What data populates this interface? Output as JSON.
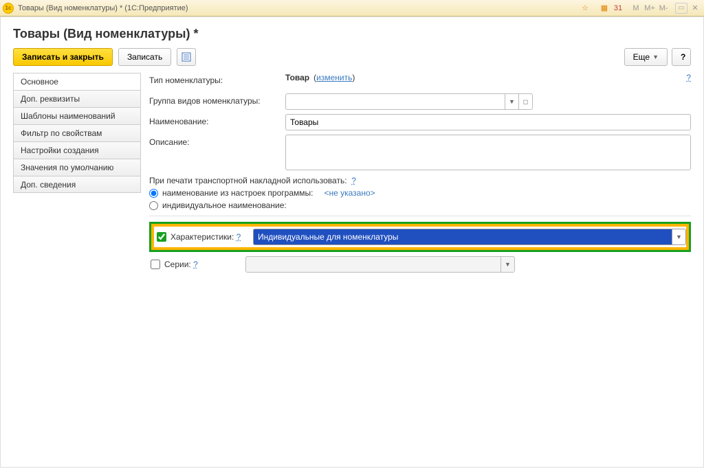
{
  "titlebar": {
    "app_icon_text": "1c",
    "title": "Товары (Вид номенклатуры) *   (1С:Предприятие)",
    "icons": {
      "star": "☆",
      "calc": "▦",
      "cal": "31",
      "m": "M",
      "mplus": "M+",
      "mminus": "M-",
      "rect": "▭",
      "close": "✕"
    }
  },
  "page": {
    "title": "Товары (Вид номенклатуры) *"
  },
  "toolbar": {
    "save_close": "Записать и закрыть",
    "save": "Записать",
    "more": "Еще",
    "help": "?"
  },
  "sidebar": [
    "Основное",
    "Доп. реквизиты",
    "Шаблоны наименований",
    "Фильтр по свойствам",
    "Настройки создания",
    "Значения по умолчанию",
    "Доп. сведения"
  ],
  "form": {
    "type_label": "Тип номенклатуры:",
    "type_value": "Товар",
    "type_change": "изменить",
    "group_label": "Группа видов номенклатуры:",
    "group_value": "",
    "name_label": "Наименование:",
    "name_value": "Товары",
    "desc_label": "Описание:",
    "desc_value": "",
    "print_label": "При печати транспортной накладной использовать:",
    "radio1": "наименование из настроек программы:",
    "not_set": "<не указано>",
    "radio2": "индивидуальное наименование:",
    "char_label": "Характеристики:",
    "char_value": "Индивидуальные для номенклатуры",
    "series_label": "Серии:",
    "help_q": "?"
  }
}
